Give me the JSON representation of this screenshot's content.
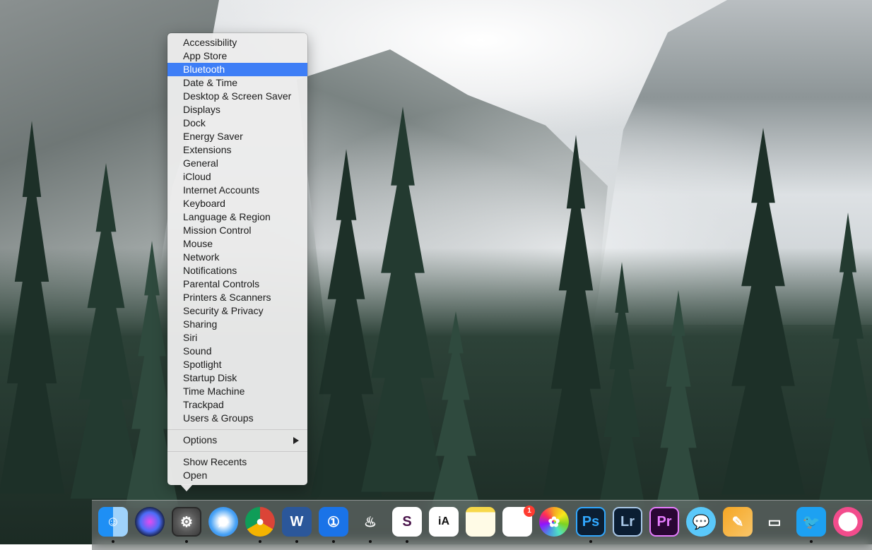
{
  "context_menu": {
    "items": [
      {
        "label": "Accessibility"
      },
      {
        "label": "App Store"
      },
      {
        "label": "Bluetooth"
      },
      {
        "label": "Date & Time"
      },
      {
        "label": "Desktop & Screen Saver"
      },
      {
        "label": "Displays"
      },
      {
        "label": "Dock"
      },
      {
        "label": "Energy Saver"
      },
      {
        "label": "Extensions"
      },
      {
        "label": "General"
      },
      {
        "label": "iCloud"
      },
      {
        "label": "Internet Accounts"
      },
      {
        "label": "Keyboard"
      },
      {
        "label": "Language & Region"
      },
      {
        "label": "Mission Control"
      },
      {
        "label": "Mouse"
      },
      {
        "label": "Network"
      },
      {
        "label": "Notifications"
      },
      {
        "label": "Parental Controls"
      },
      {
        "label": "Printers & Scanners"
      },
      {
        "label": "Security & Privacy"
      },
      {
        "label": "Sharing"
      },
      {
        "label": "Siri"
      },
      {
        "label": "Sound"
      },
      {
        "label": "Spotlight"
      },
      {
        "label": "Startup Disk"
      },
      {
        "label": "Time Machine"
      },
      {
        "label": "Trackpad"
      },
      {
        "label": "Users & Groups"
      }
    ],
    "selected": "Bluetooth",
    "options_label": "Options",
    "show_recents_label": "Show Recents",
    "open_label": "Open",
    "selection_color": "#3e7ef6"
  },
  "dock": {
    "apps": [
      {
        "name": "Finder",
        "icon": "finder-icon",
        "running": true
      },
      {
        "name": "Siri",
        "icon": "siri-icon",
        "running": false
      },
      {
        "name": "System Preferences",
        "icon": "system-preferences-icon",
        "running": true
      },
      {
        "name": "Safari",
        "icon": "safari-icon",
        "running": false
      },
      {
        "name": "Chrome",
        "icon": "chrome-icon",
        "running": true
      },
      {
        "name": "Word",
        "icon": "word-icon",
        "text": "W",
        "running": true
      },
      {
        "name": "1Password",
        "icon": "onepassword-icon",
        "running": true
      },
      {
        "name": "Alfred",
        "icon": "alfred-icon",
        "running": true
      },
      {
        "name": "Slack",
        "icon": "slack-icon",
        "text": "S",
        "running": true
      },
      {
        "name": "iA Writer",
        "icon": "ia-writer-icon",
        "text": "iA",
        "running": false
      },
      {
        "name": "Notes",
        "icon": "notes-icon",
        "running": false
      },
      {
        "name": "Reminders",
        "icon": "reminders-icon",
        "badge": "1",
        "running": false
      },
      {
        "name": "Photos",
        "icon": "photos-icon",
        "running": false
      },
      {
        "name": "Photoshop",
        "icon": "photoshop-icon",
        "text": "Ps",
        "running": true
      },
      {
        "name": "Lightroom",
        "icon": "lightroom-icon",
        "text": "Lr",
        "running": false
      },
      {
        "name": "Premiere",
        "icon": "premiere-icon",
        "text": "Pr",
        "running": false
      },
      {
        "name": "Messages",
        "icon": "messages-icon",
        "running": false
      },
      {
        "name": "Pages",
        "icon": "pages-icon",
        "running": false
      },
      {
        "name": "Keynote",
        "icon": "keynote-icon",
        "running": false
      },
      {
        "name": "Twitter",
        "icon": "twitter-icon",
        "running": true
      },
      {
        "name": "iTunes",
        "icon": "itunes-icon",
        "running": false
      }
    ]
  }
}
